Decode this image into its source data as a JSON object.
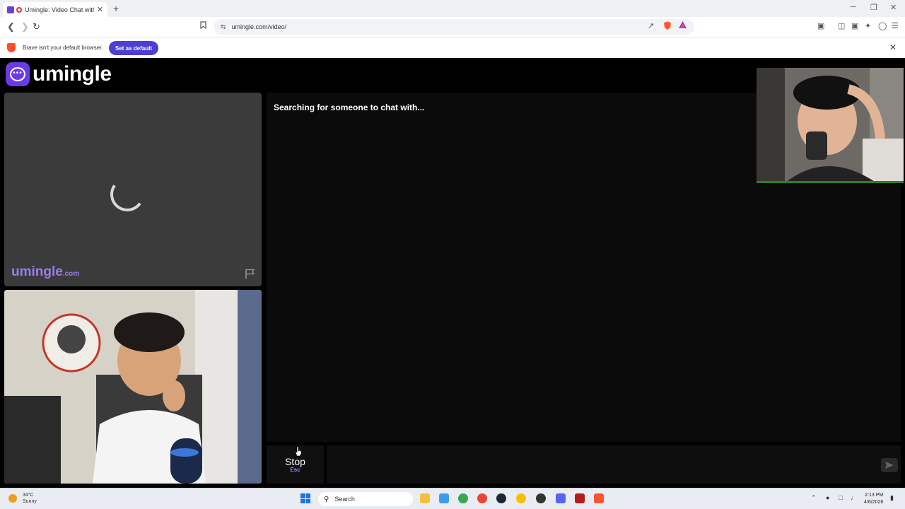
{
  "browser": {
    "tab_title": "Umingle: Video Chat with Str",
    "tab_close": "✕",
    "new_tab": "+",
    "url": "umingle.com/video/",
    "window_controls": {
      "minimize": "─",
      "restore": "❐",
      "close": "✕"
    }
  },
  "infobar": {
    "message": "Brave isn't your default browser",
    "set_default_label": "Set as default",
    "close": "✕"
  },
  "site": {
    "logo_text": "umingle",
    "logo_dots": "•••",
    "watermark_main": "umingle",
    "watermark_suffix": ".com",
    "status_text": "Searching for someone to chat with...",
    "stop_label": "Stop",
    "stop_key": "Esc",
    "message_placeholder": ""
  },
  "taskbar": {
    "weather_temp": "34°C",
    "weather_desc": "Sunny",
    "search_label": "Search",
    "time": "2:13 PM",
    "date": "4/6/2026"
  },
  "colors": {
    "brand_purple": "#6c3be6",
    "watermark_purple": "#9b7cf0",
    "set_default_bg": "#4b3fd8"
  }
}
